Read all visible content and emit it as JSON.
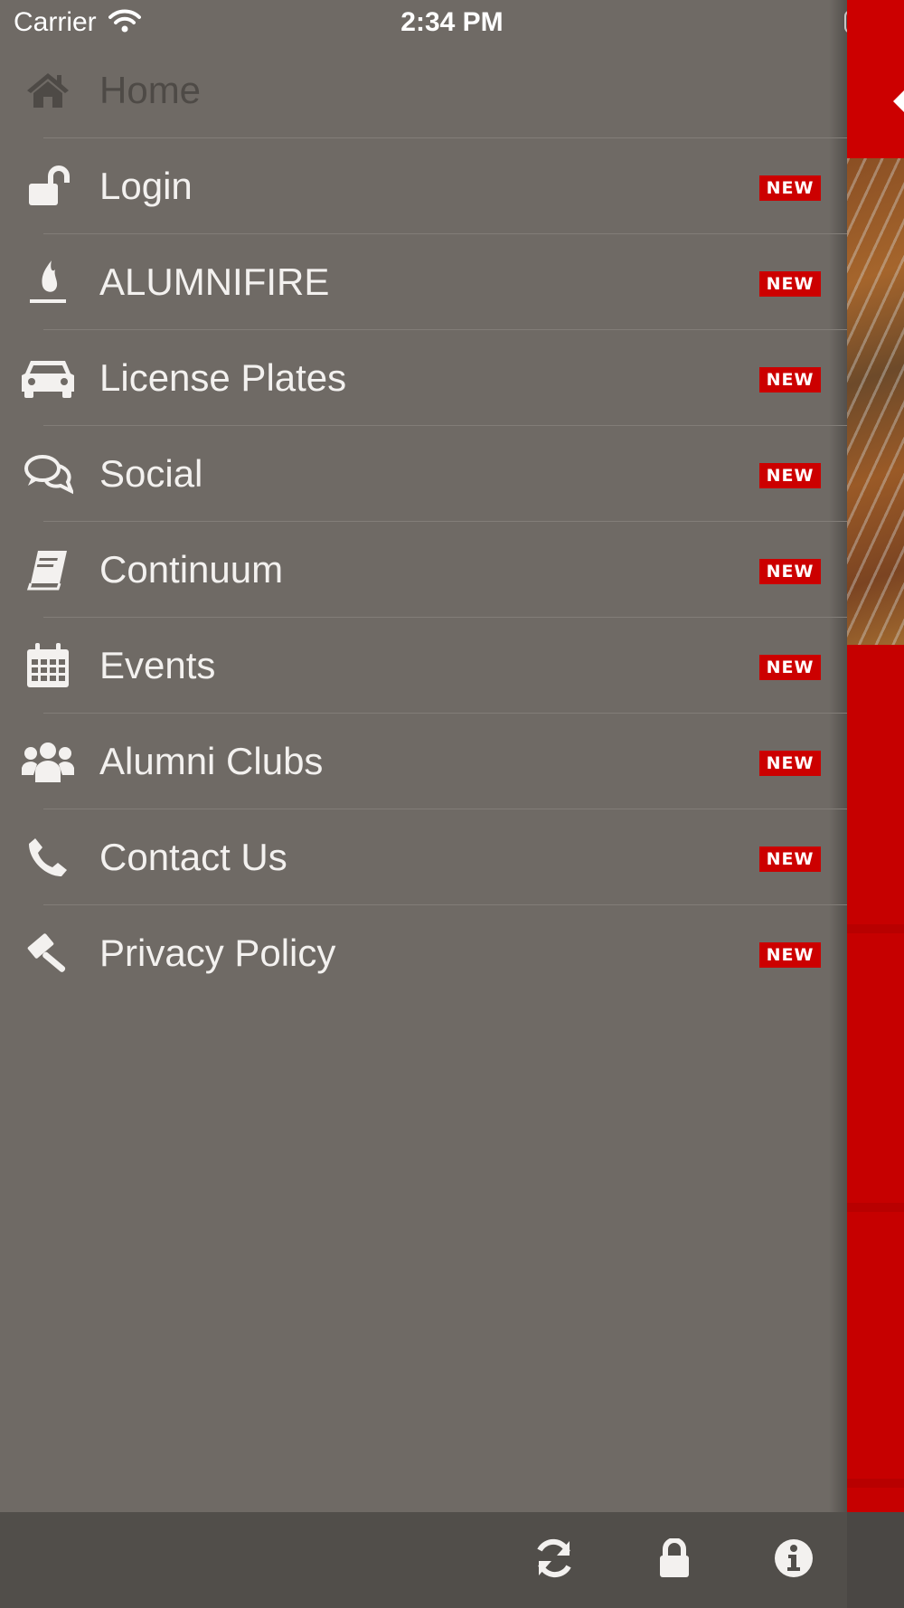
{
  "status_bar": {
    "carrier": "Carrier",
    "time": "2:34 PM"
  },
  "menu": {
    "items": [
      {
        "label": "Home",
        "icon": "home-icon"
      },
      {
        "label": "Login",
        "icon": "unlock-icon",
        "badge": "NEW"
      },
      {
        "label": "ALUMNIFIRE",
        "icon": "flame-icon",
        "badge": "NEW"
      },
      {
        "label": "License Plates",
        "icon": "car-icon",
        "badge": "NEW"
      },
      {
        "label": "Social",
        "icon": "chat-bubbles-icon",
        "badge": "NEW"
      },
      {
        "label": "Continuum",
        "icon": "book-icon",
        "badge": "NEW"
      },
      {
        "label": "Events",
        "icon": "calendar-icon",
        "badge": "NEW"
      },
      {
        "label": "Alumni Clubs",
        "icon": "users-icon",
        "badge": "NEW"
      },
      {
        "label": "Contact Us",
        "icon": "phone-icon",
        "badge": "NEW"
      },
      {
        "label": "Privacy Policy",
        "icon": "gavel-icon",
        "badge": "NEW"
      }
    ]
  },
  "toolbar": {
    "buttons": [
      {
        "icon": "refresh-icon"
      },
      {
        "icon": "lock-icon"
      },
      {
        "icon": "info-icon"
      }
    ]
  },
  "colors": {
    "menu_background": "#6f6a65",
    "badge": "#cc0000",
    "accent": "#cc0000",
    "toolbar": "#514e4a"
  }
}
